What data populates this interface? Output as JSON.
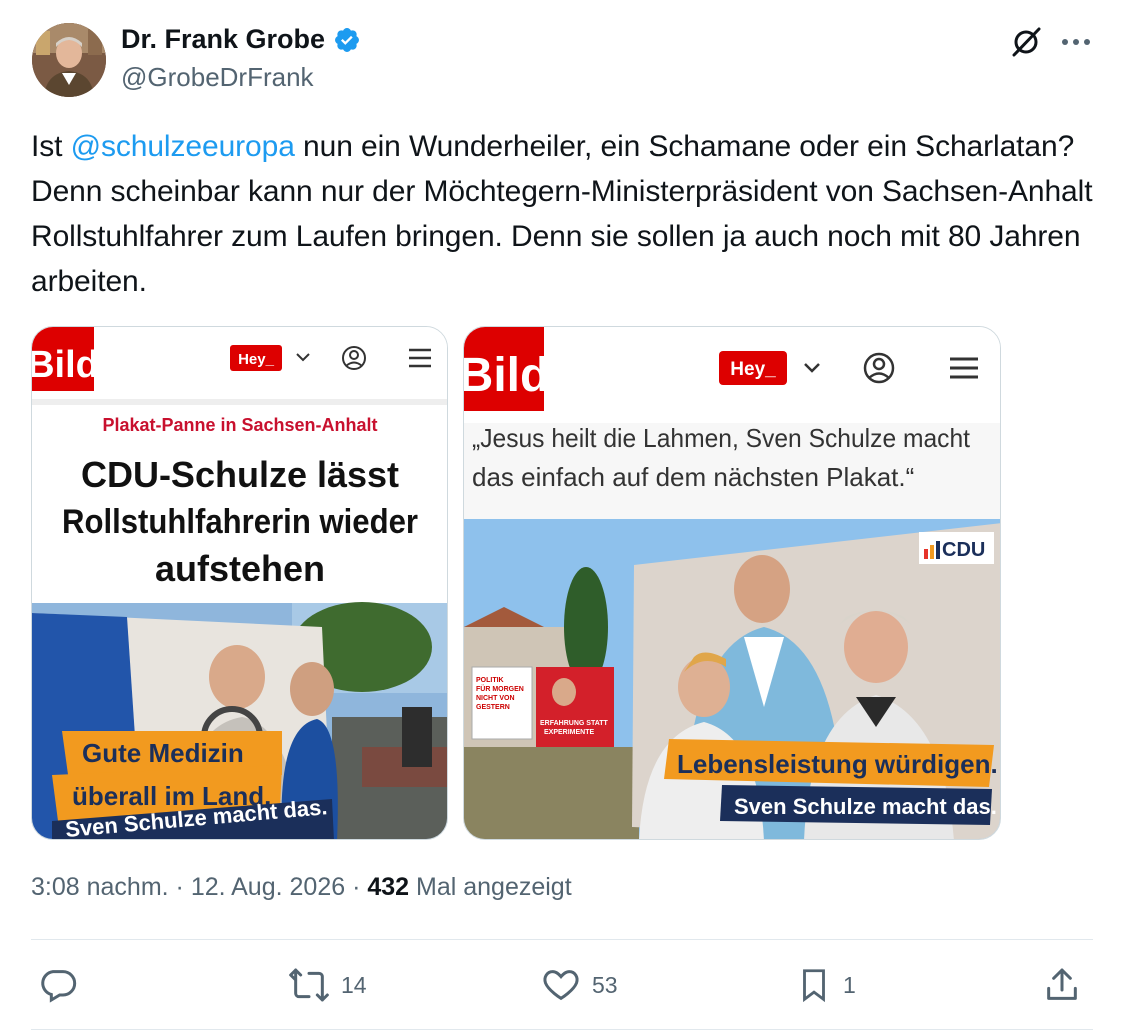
{
  "author": {
    "display_name": "Dr. Frank Grobe",
    "handle": "@GrobeDrFrank",
    "verified": true
  },
  "tweet": {
    "text_before": "Ist ",
    "mention": "@schulzeeuropa",
    "text_after": " nun ein Wunderheiler, ein Schamane oder ein Scharlatan? Denn scheinbar kann nur der Möchtegern-Ministerpräsident von Sachsen-Anhalt Rollstuhlfahrer zum Laufen bringen. Denn sie sollen ja auch noch mit 80 Jahren arbeiten."
  },
  "media": {
    "left": {
      "logo": "Bild",
      "hey": "Hey_",
      "kicker": "Plakat-Panne in Sachsen-Anhalt",
      "headline_line1": "CDU-Schulze lässt",
      "headline_line2": "Rollstuhlfahrerin wieder",
      "headline_line3": "aufstehen",
      "poster_line1": "Gute Medizin",
      "poster_line2": "überall im Land.",
      "poster_line3": "Sven Schulze macht das."
    },
    "right": {
      "logo": "Bild",
      "hey": "Hey_",
      "quote_line1": "„Jesus heilt die Lahmen, Sven Schulze macht",
      "quote_line2": "das einfach auf dem nächsten Plakat.“",
      "cdu": "CDU",
      "small_poster1_line1": "POLITIK",
      "small_poster1_line2": "FÜR MORGEN",
      "small_poster1_line3": "NICHT VON",
      "small_poster1_line4": "GESTERN",
      "small_poster2_line1": "ERFAHRUNG STATT",
      "small_poster2_line2": "EXPERIMENTE",
      "poster_line1": "Lebensleistung würdigen.",
      "poster_line2": "Sven Schulze macht das."
    }
  },
  "meta": {
    "time": "3:08 nachm.",
    "sep1": " · ",
    "date": "12. Aug. 2026",
    "sep2": " · ",
    "views": "432",
    "views_label": " Mal angezeigt"
  },
  "actions": {
    "replies": "",
    "retweets": "14",
    "likes": "53",
    "bookmarks": "1"
  },
  "colors": {
    "accent": "#1d9bf0",
    "bild_red": "#dd0000",
    "orange": "#f29a1f"
  }
}
